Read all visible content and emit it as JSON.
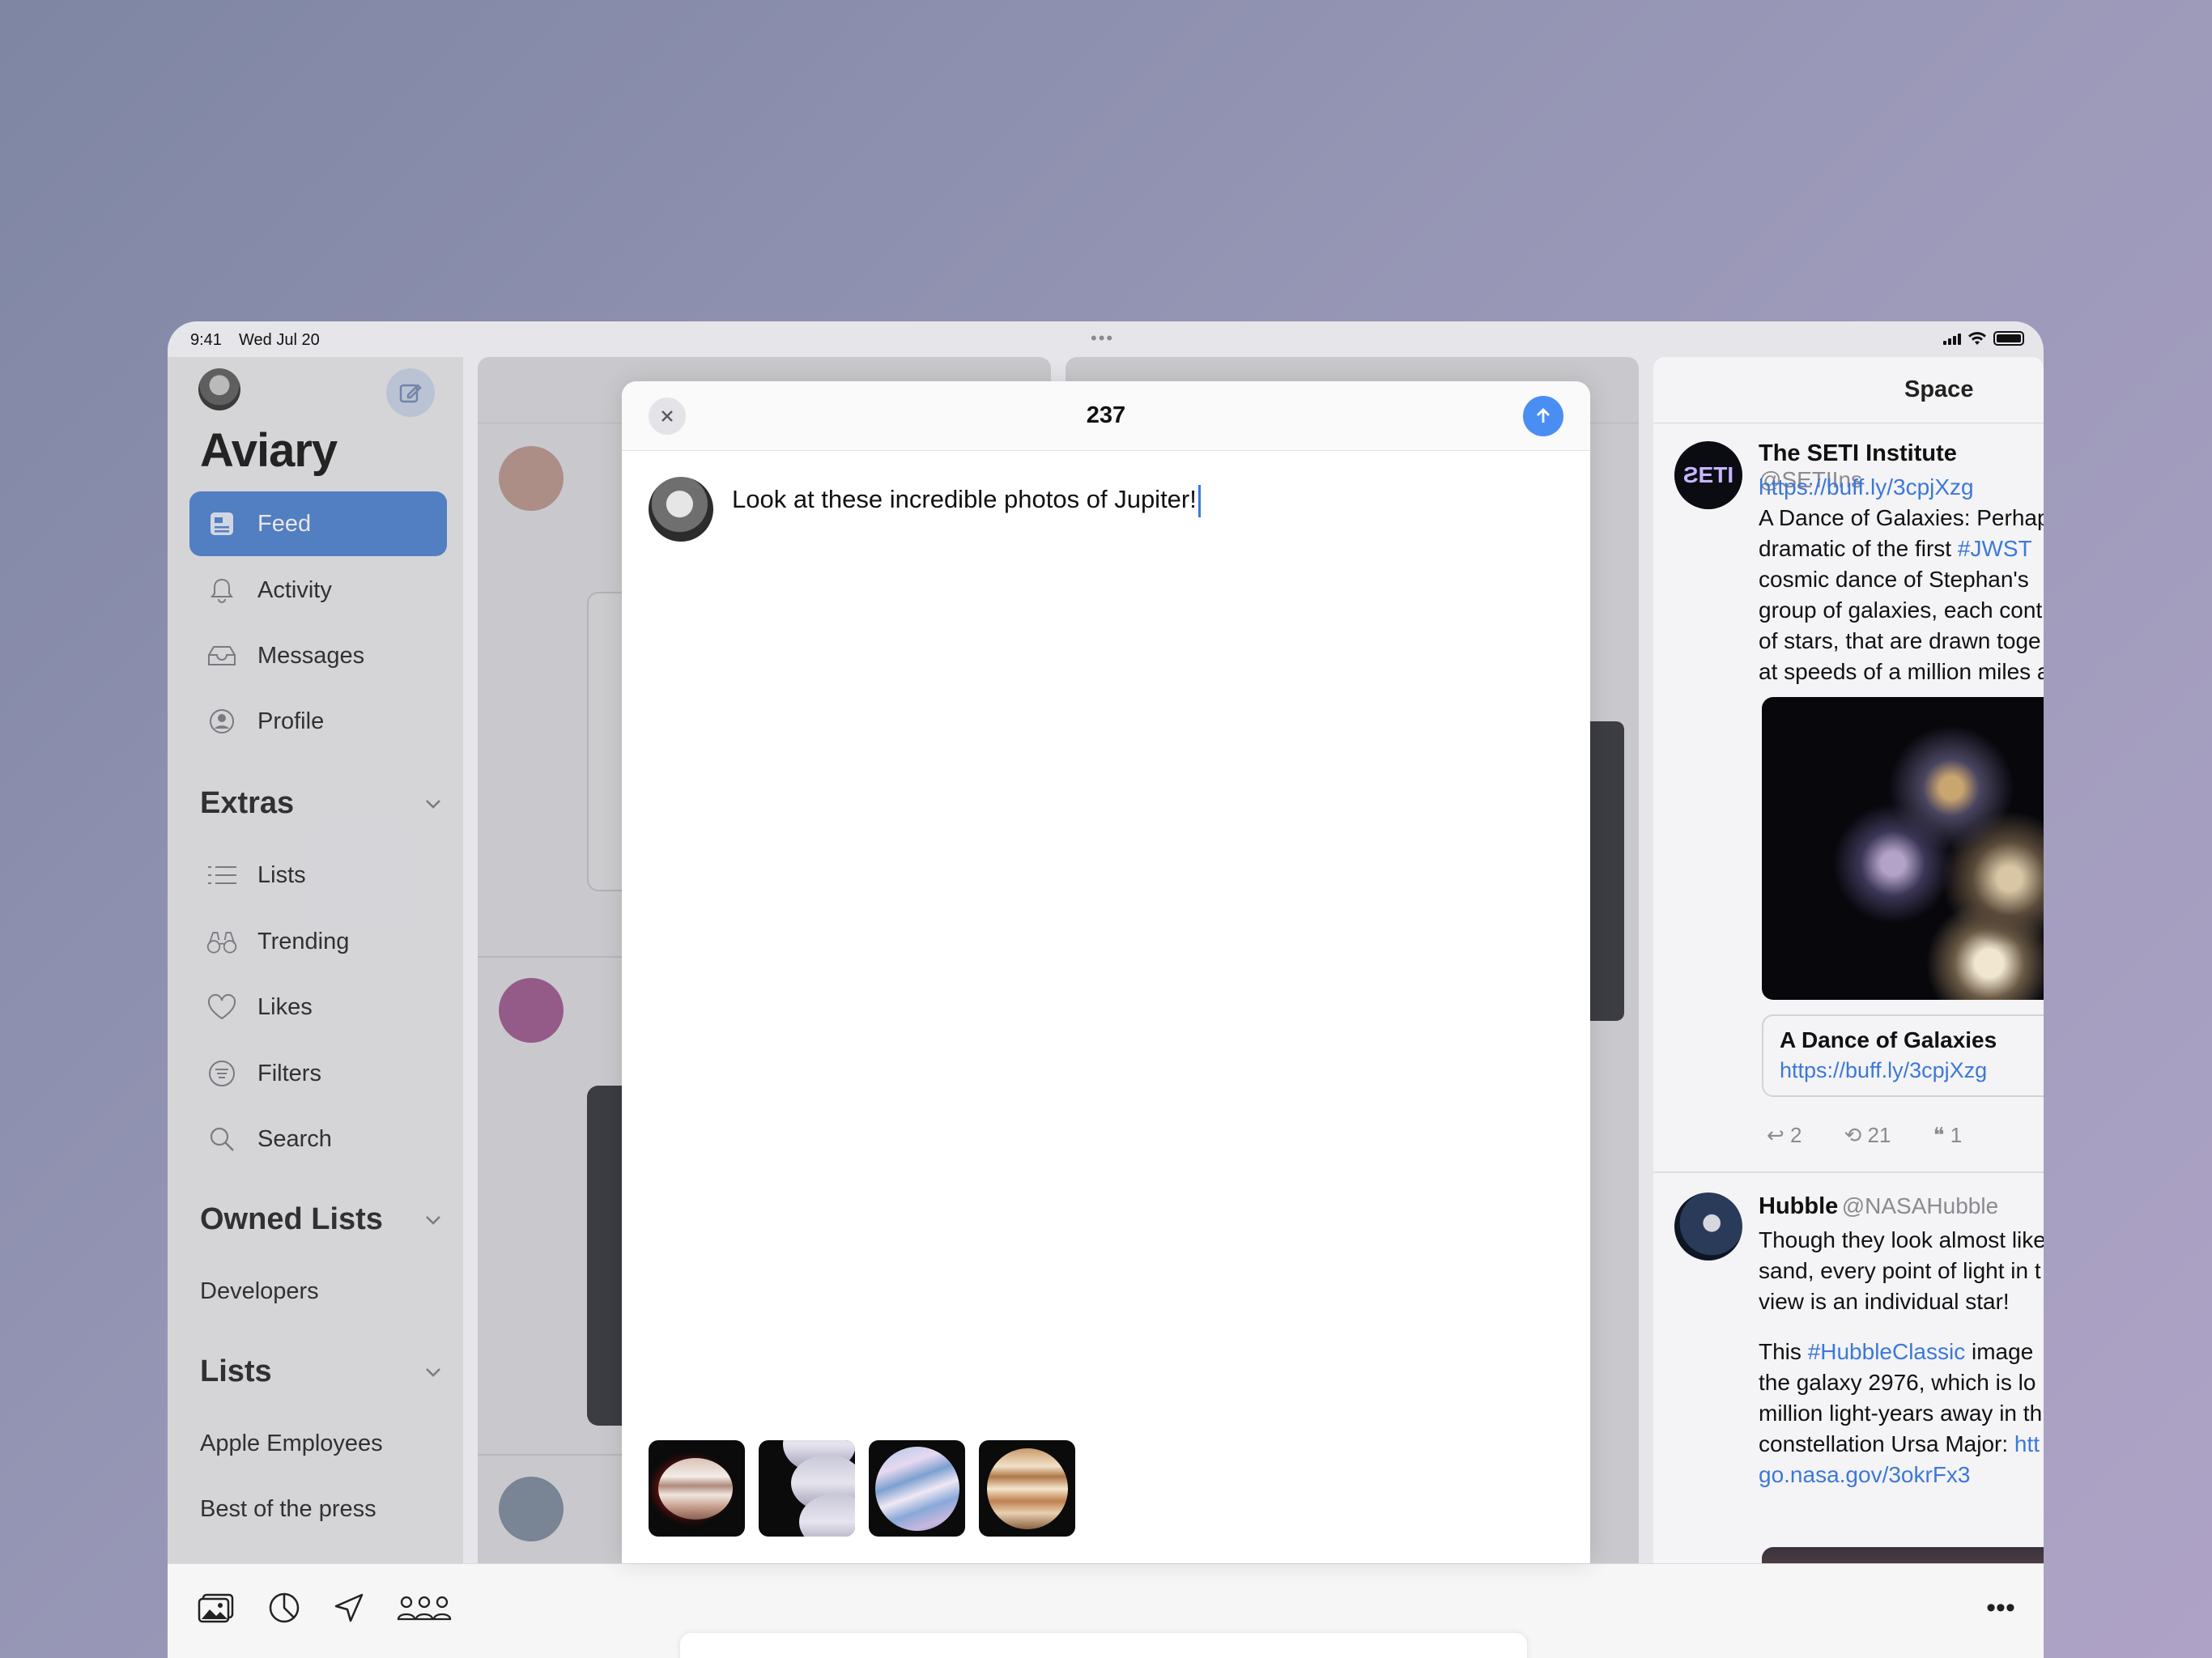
{
  "status": {
    "time": "9:41",
    "date": "Wed Jul 20"
  },
  "sidebar": {
    "app_title": "Aviary",
    "nav": [
      {
        "label": "Feed",
        "icon": "feed-icon",
        "active": true
      },
      {
        "label": "Activity",
        "icon": "bell-icon"
      },
      {
        "label": "Messages",
        "icon": "tray-icon"
      },
      {
        "label": "Profile",
        "icon": "person-icon"
      }
    ],
    "extras_title": "Extras",
    "extras": [
      {
        "label": "Lists",
        "icon": "list-icon"
      },
      {
        "label": "Trending",
        "icon": "binoculars-icon"
      },
      {
        "label": "Likes",
        "icon": "heart-icon"
      },
      {
        "label": "Filters",
        "icon": "filter-icon"
      },
      {
        "label": "Search",
        "icon": "search-icon"
      }
    ],
    "owned_lists_title": "Owned Lists",
    "owned_lists": [
      "Developers"
    ],
    "lists_title": "Lists",
    "lists": [
      "Apple Employees",
      "Best of the press"
    ]
  },
  "columns": {
    "space": {
      "title": "Space",
      "tweets": [
        {
          "name": "The SETI Institute",
          "handle": "@SETIIns",
          "link": "https://buff.ly/3cpjXzg",
          "lines": [
            "A Dance of Galaxies: Perhap",
            "dramatic of the first ",
            "cosmic dance of Stephan's ",
            "group of galaxies, each cont",
            "of stars, that are drawn toge",
            "at speeds of a million miles a"
          ],
          "hashtag": "#JWST",
          "card_title": "A Dance of Galaxies",
          "card_link": "https://buff.ly/3cpjXzg",
          "replies": "2",
          "retweets": "21",
          "quotes": "1"
        },
        {
          "name": "Hubble",
          "handle": "@NASAHubble",
          "lines": [
            "Though they look almost like",
            "sand, every point of light in t",
            "view is an individual star!"
          ],
          "lines2_prefix": "This ",
          "hashtag": "#HubbleClassic",
          "lines2_suffix": " image",
          "lines3": [
            "the galaxy 2976, which is lo",
            "million light-years away in th",
            "constellation Ursa Major: "
          ],
          "link_part": "htt",
          "link2": "go.nasa.gov/3okrFx3"
        }
      ]
    }
  },
  "composer": {
    "counter": "237",
    "text": "Look at these incredible photos of Jupiter!",
    "attachments": [
      "jupiter-photo-1",
      "jupiter-photo-2",
      "jupiter-photo-3",
      "jupiter-photo-4"
    ]
  },
  "toolbar": {
    "icons": [
      "photo-library-icon",
      "poll-icon",
      "location-icon",
      "accounts-icon",
      "more-icon"
    ]
  },
  "colors": {
    "accent": "#4a7fd1",
    "send": "#4a8ef3",
    "link": "#3c78d8"
  }
}
